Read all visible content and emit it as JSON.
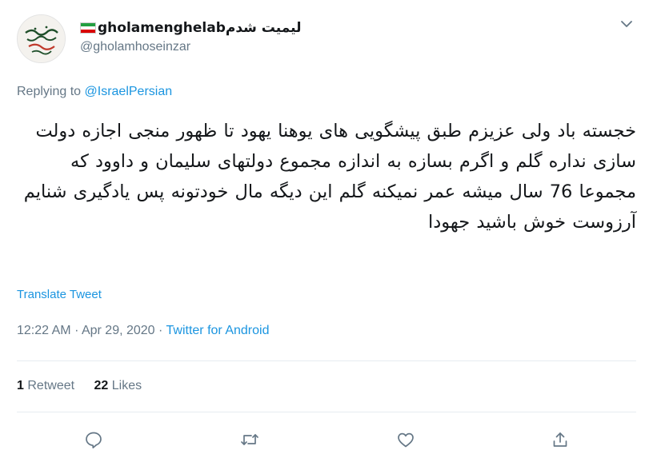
{
  "user": {
    "display_name": "لیمیت شدمgholamenghelab",
    "handle": "@gholamhoseinzar",
    "avatar_icon": "calligraphy-avatar-icon",
    "flag_icon": "iran-flag-icon"
  },
  "reply": {
    "prefix": "Replying to",
    "mention": "@IsraelPersian"
  },
  "tweet": {
    "text": "خجسته باد ولی عزیزم طبق پیشگویی های یوهنا یهود تا ظهور منجی اجازه دولت سازی نداره گلم و اگرم بسازه به اندازه مجموع دولتهای سلیمان و داوود که مجموعا 76 سال میشه عمر نمیکنه گلم این دیگه مال خودتونه پس یادگیری شنایم آرزوست خوش باشید جهودا"
  },
  "translate_label": "Translate Tweet",
  "meta": {
    "time": "12:22 AM",
    "separator1": "·",
    "date": "Apr 29, 2020",
    "separator2": "·",
    "source": "Twitter for Android"
  },
  "stats": {
    "retweets_count": "1",
    "retweets_label": "Retweet",
    "likes_count": "22",
    "likes_label": "Likes"
  },
  "actions": [
    "reply-icon",
    "retweet-icon",
    "like-icon",
    "share-icon"
  ],
  "colors": {
    "link": "#1b95e0",
    "secondary_text": "#657786",
    "primary_text": "#14171a",
    "divider": "#e6ecf0",
    "flag_green": "#239f40",
    "flag_red": "#da0000"
  }
}
